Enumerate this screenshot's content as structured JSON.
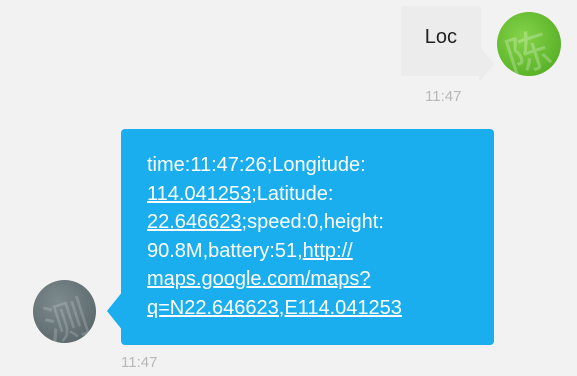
{
  "outgoing": {
    "text": "Loc",
    "time": "11:47",
    "avatar_glyph": "陈",
    "avatar_color": "#6cc13a"
  },
  "incoming": {
    "time": "11:47",
    "avatar_glyph": "测",
    "avatar_color": "#6b777b",
    "bubble_color": "#1aaeee",
    "body": {
      "p1": "time:11:47:26;Longitude:",
      "lon_link": "114.041253",
      "p2": ";Latitude:",
      "lat_link": "22.646623",
      "p3": ";speed:0,height:",
      "p4": "90.8M,battery:51,",
      "url_line1": "http://",
      "url_line2": "maps.google.com/maps?",
      "url_line3": "q=N22.646623,E114.041253"
    }
  }
}
